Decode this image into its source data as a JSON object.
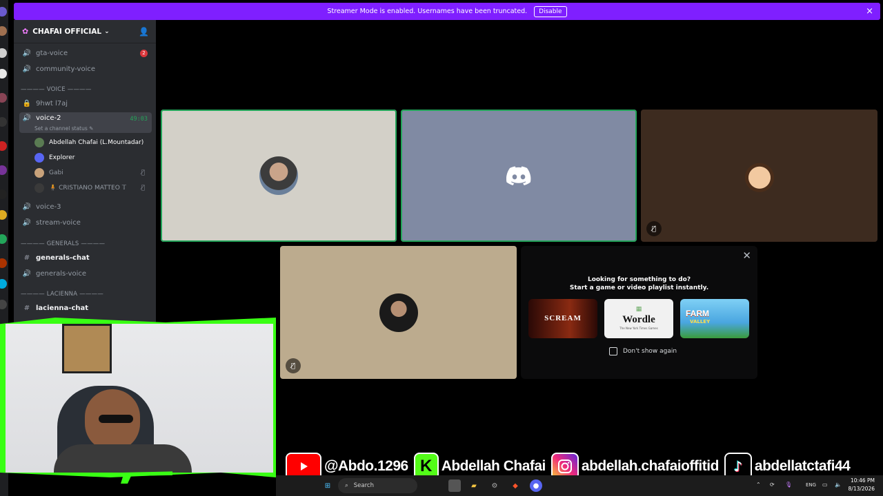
{
  "banner": {
    "message": "Streamer Mode is enabled. Usernames have been truncated.",
    "disable_label": "Disable",
    "close_icon": "×"
  },
  "server": {
    "name": "CHAFAI OFFICIAL",
    "channels": [
      {
        "name": "gta-voice",
        "type": "voice",
        "badge": "2"
      },
      {
        "name": "community-voice",
        "type": "voice"
      }
    ],
    "voice_category": "———— VOICE ————",
    "locked_channel": "9hwt l7aj",
    "active_voice": {
      "name": "voice-2",
      "timer": "49:03",
      "status_placeholder": "Set a channel status ✎",
      "members": [
        {
          "name": "Abdellah Chafai (L.Mountadar)",
          "muted": false,
          "avatar_color": "#5a7b52"
        },
        {
          "name": "Explorer",
          "muted": false,
          "avatar_color": "#5865f2"
        },
        {
          "name": "Gabi",
          "muted": true,
          "avatar_color": "#c8a27a"
        },
        {
          "name": "🧍 CRISTIANO MATTEO 𝕋",
          "muted": true,
          "avatar_color": "#3a3a3a"
        }
      ]
    },
    "more_voice": [
      {
        "name": "voice-3"
      },
      {
        "name": "stream-voice"
      }
    ],
    "generals_category": "———— GENERALS ————",
    "generals": [
      {
        "name": "generals-chat",
        "type": "text",
        "bold": true
      },
      {
        "name": "generals-voice",
        "type": "voice"
      }
    ],
    "lacienna_category": "———— LACIENNA ————",
    "lacienna": [
      {
        "name": "lacienna-chat",
        "type": "text",
        "bold": true
      }
    ]
  },
  "tiles": [
    {
      "bg": "#d3d0c8",
      "speaking": true,
      "avatar": "person-glasses"
    },
    {
      "bg": "#808aa3",
      "speaking": true,
      "avatar": "discord-logo"
    },
    {
      "bg": "#3d2b1f",
      "speaking": false,
      "avatar": "cartoon-boy",
      "muted": true
    },
    {
      "bg": "#bcab8e",
      "speaking": false,
      "avatar": "man-suit",
      "muted": true
    }
  ],
  "activity": {
    "line1": "Looking for something to do?",
    "line2": "Start a game or video playlist instantly.",
    "cards": [
      {
        "title": "SCREAM",
        "subtitle": "",
        "bg": "#6b1a10"
      },
      {
        "title": "Wordle",
        "subtitle": "The New York Times Games",
        "bg": "#f1f1f1"
      },
      {
        "title": "FARM",
        "subtitle": "VALLEY",
        "bg": "#5fb7e8"
      }
    ],
    "checkbox_label": "Don't show again"
  },
  "socials": [
    {
      "icon": "youtube-icon",
      "handle": "@Abdo.1296",
      "color": "#ff0000"
    },
    {
      "icon": "kick-icon",
      "handle": "Abdellah Chafai",
      "color": "#53fc18"
    },
    {
      "icon": "instagram-icon",
      "handle": "abdellah.chafaioffitid",
      "color": "#d6249f"
    },
    {
      "icon": "tiktok-icon",
      "handle": "abdellatctafi44",
      "color": "#010101"
    }
  ],
  "taskbar": {
    "search_placeholder": "Search",
    "lang": "ENG",
    "time": "10:46 PM",
    "date": "8/13/2026"
  }
}
